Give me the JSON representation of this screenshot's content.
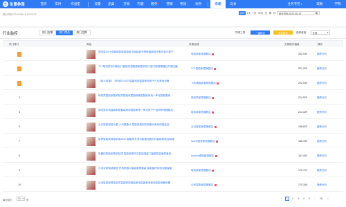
{
  "brand": {
    "name": "生意参谋",
    "mark": "生"
  },
  "nav": [
    {
      "label": "首页"
    },
    {
      "label": "实时"
    },
    {
      "label": "作战室"
    },
    {
      "label": "流量"
    },
    {
      "label": "品类",
      "hot": true
    },
    {
      "label": "交易"
    },
    {
      "label": "内容"
    },
    {
      "label": "服务",
      "hot": true
    },
    {
      "label": "营销"
    },
    {
      "label": "物流",
      "hot": true
    },
    {
      "label": "财务"
    },
    {
      "label": "市场",
      "active": true
    },
    {
      "label": "竞争"
    },
    {
      "label": "业务专区",
      "caret": "▾"
    },
    {
      "label": "取数"
    },
    {
      "label": "学院"
    }
  ],
  "datebar": {
    "periods": [
      "实时",
      "1天",
      "7天",
      "30天",
      "日",
      "周",
      "月"
    ],
    "active_period": "实时",
    "date_picker": "统计时间 2020-06-18",
    "update_text": "统计时间 2019-08-18 23:00:02"
  },
  "monitor": {
    "title": "行业监控",
    "tabs": [
      "热门店铺",
      "热门商品",
      "热门品牌"
    ],
    "active_tab": "热门商品",
    "filter_label": "同城工具：",
    "pill_blue": "一键转化",
    "pill_yellow": "导出排名",
    "select_label": "趋势维度：",
    "select_value": "全部",
    "columns": {
      "rank": "热门排行",
      "product": "商品",
      "shop": "所属店铺",
      "score": "交易增长幅度",
      "op": "操作"
    }
  },
  "rows": [
    {
      "rank": "1",
      "medal": true,
      "title": "哈哈笑2019全新款智能纸抽纸巾抽纸盒子厨房抽纸盒子客厅纸巾盒子",
      "shop": "哈哈笑家居旗舰店",
      "score": "252,040",
      "op": "趋势分析"
    },
    {
      "rank": "2",
      "medal": true,
      "title": "TCL哈哈笑系列新品门窗磁传感智能家居安防门窗门磁报警器红外感应器",
      "shop": "TCL智能家居旗舰店",
      "score": "251,325",
      "op": "趋势分析"
    },
    {
      "rank": "3",
      "medal": true,
      "title": "【双11特惠】飞利浦TV2023智能电视智能家电电子产品家用设备",
      "shop": "飞利浦智能家居旗舰店",
      "score": "232,049",
      "op": "趋势分析"
    },
    {
      "rank": "4",
      "medal": false,
      "title": "哈哈笑智能家居哈哈笑智能家居厨房套装智能家电一体化智能厨房",
      "shop": "哈哈笑家居旗舰店",
      "score": "224,525",
      "op": "趋势分析"
    },
    {
      "rank": "5",
      "medal": false,
      "title": "哈哈笑手机智能家居套装家用智能家电一体化电子产品厨房电器新品",
      "shop": "哈哈笑家居旗舰店",
      "score": "213,329",
      "op": "趋势分析"
    },
    {
      "rank": "6",
      "medal": false,
      "title": "云分智能家居小爱 小米摄像头 智能家居安防摄像头家用网络监控",
      "shop": "云分智能家居旗舰店",
      "score": "188,625",
      "op": "趋势分析"
    },
    {
      "rank": "7",
      "medal": false,
      "title": "智慧智能家居哈哈笑2020 智能网关多功能遥控器无线智能家居控制器",
      "shop": "fanzhi智慧家居旗舰店",
      "score": "186,759",
      "op": "趋势分析"
    },
    {
      "rank": "8",
      "medal": false,
      "title": "机器控智能家居哈哈笑 智能家居开关智能插座门窗磁智能家居套装",
      "shop": "kaadas德施曼旗舰店",
      "score": "181,400",
      "op": "趋势分析"
    },
    {
      "rank": "9",
      "medal": false,
      "title": "小米米家智能家居 扫地机器人智能家居套装 智能窗帘电机全屋智能",
      "shop": "哈哈笑家居旗舰店",
      "score": "172,724",
      "op": "趋势分析"
    },
    {
      "rank": "10",
      "medal": false,
      "title": "云米智能家居哈哈笑智能家居套装家用智能家电新品智能电器设备",
      "shop": "云米智能家居旗舰店",
      "score": "170,349",
      "op": "趋势分析"
    }
  ],
  "pager": {
    "per_page_label": "每页显示",
    "per_page_value": "10",
    "unit": "条",
    "pages": [
      "1",
      "2",
      "3",
      "4",
      "5",
      "...",
      "30"
    ],
    "prev": "‹",
    "next": "›"
  }
}
